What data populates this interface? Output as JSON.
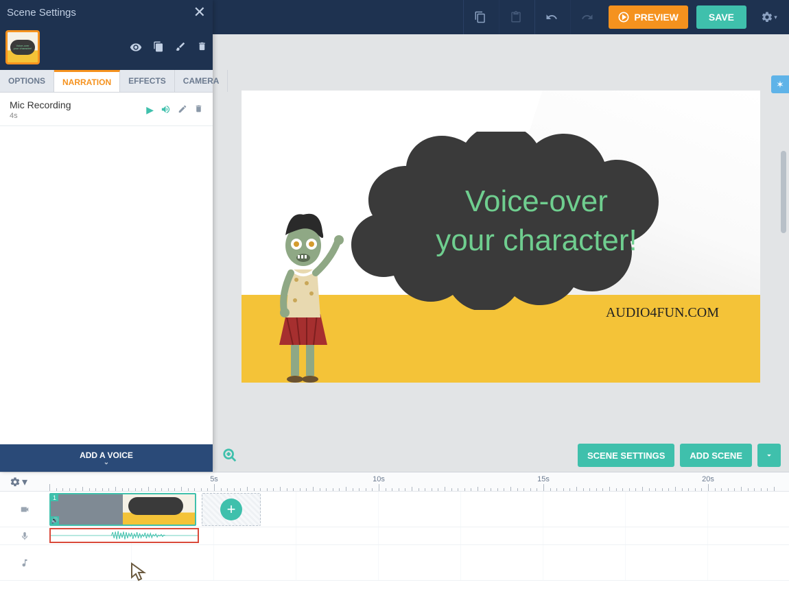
{
  "panel": {
    "title": "Scene Settings",
    "tabs": [
      "OPTIONS",
      "NARRATION",
      "EFFECTS",
      "CAMERA"
    ],
    "active_tab": "NARRATION",
    "recording": {
      "title": "Mic Recording",
      "duration": "4s"
    },
    "footer": "ADD A VOICE"
  },
  "toolbar": {
    "preview": "PREVIEW",
    "save": "SAVE"
  },
  "controls": {
    "scene_settings": "SCENE SETTINGS",
    "add_scene": "ADD SCENE"
  },
  "canvas": {
    "line1": "Voice-over",
    "line2": "your character!",
    "watermark": "AUDIO4FUN.COM"
  },
  "timeline": {
    "scene_number": "1",
    "marks": [
      "5s",
      "10s",
      "15s",
      "20s"
    ]
  }
}
